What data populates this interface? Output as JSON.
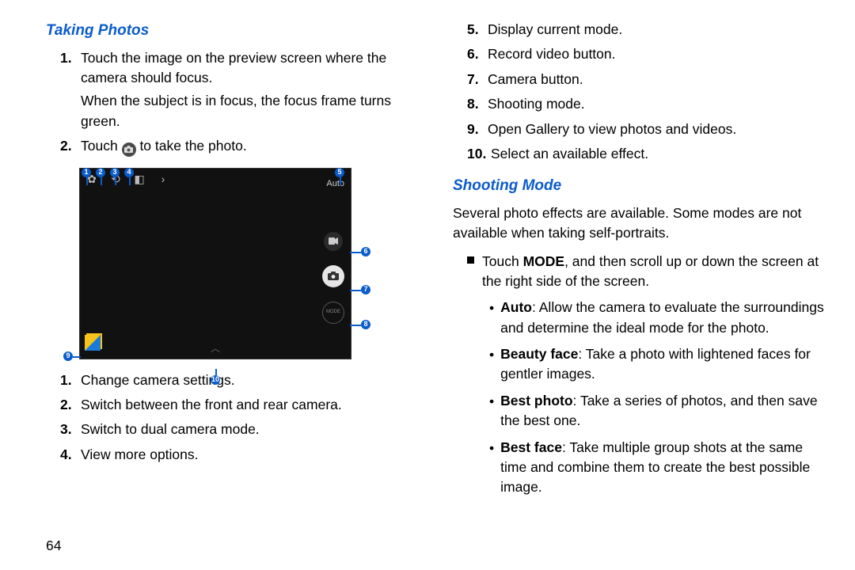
{
  "page_number": "64",
  "left": {
    "heading": "Taking Photos",
    "steps": [
      {
        "num": "1.",
        "text": "Touch the image on the preview screen where the camera should focus.",
        "extra": "When the subject is in focus, the focus frame turns green."
      },
      {
        "num": "2.",
        "pre": "Touch ",
        "post": " to take the photo."
      }
    ],
    "legend_a": [
      {
        "num": "1.",
        "text": "Change camera settings."
      },
      {
        "num": "2.",
        "text": "Switch between the front and rear camera."
      },
      {
        "num": "3.",
        "text": "Switch to dual camera mode."
      },
      {
        "num": "4.",
        "text": "View more options."
      }
    ],
    "callouts": {
      "c1": "1",
      "c2": "2",
      "c3": "3",
      "c4": "4",
      "c5": "5",
      "c6": "6",
      "c7": "7",
      "c8": "8",
      "c9": "9",
      "c10": "10"
    },
    "cam": {
      "auto_label": "Auto",
      "mode_label": "MODE"
    }
  },
  "right": {
    "legend_b": [
      {
        "num": "5.",
        "text": "Display current mode."
      },
      {
        "num": "6.",
        "text": "Record video button."
      },
      {
        "num": "7.",
        "text": "Camera button."
      },
      {
        "num": "8.",
        "text": "Shooting mode."
      },
      {
        "num": "9.",
        "text": "Open Gallery to view photos and videos."
      },
      {
        "num": "10.",
        "text": "Select an available effect."
      }
    ],
    "heading": "Shooting Mode",
    "intro": "Several photo effects are available. Some modes are not available when taking self-portraits.",
    "touch_mode_pre": "Touch ",
    "touch_mode_bold": "MODE",
    "touch_mode_post": ", and then scroll up or down the screen at the right side of the screen.",
    "modes": [
      {
        "name": "Auto",
        "desc": ": Allow the camera to evaluate the surroundings and determine the ideal mode for the photo."
      },
      {
        "name": "Beauty face",
        "desc": ": Take a photo with lightened faces for gentler images."
      },
      {
        "name": "Best photo",
        "desc": ": Take a series of photos, and then save the best one."
      },
      {
        "name": "Best face",
        "desc": ": Take multiple group shots at the same time and combine them to create the best possible image."
      }
    ]
  }
}
